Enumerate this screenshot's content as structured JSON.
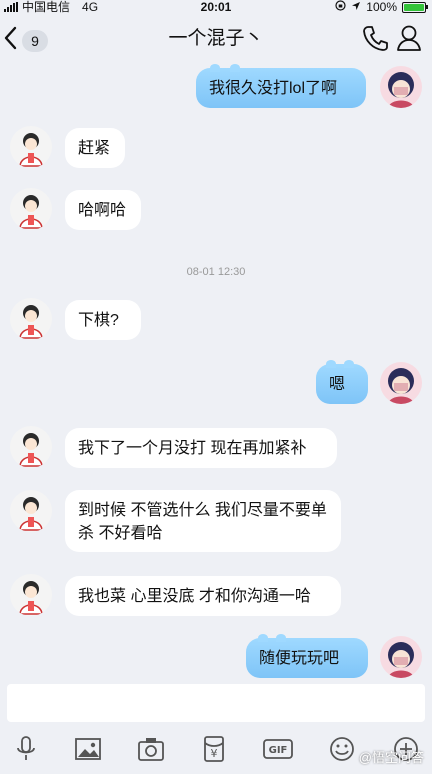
{
  "status": {
    "carrier": "中国电信",
    "network": "4G",
    "time": "20:01",
    "battery": "100%",
    "battery_level": 1.0
  },
  "nav": {
    "back_count": "9",
    "title": "一个混子丶"
  },
  "messages": [
    {
      "side": "out",
      "text": "我很久没打lol了啊"
    },
    {
      "side": "in",
      "text": "赶紧"
    },
    {
      "side": "in",
      "text": "哈啊哈"
    },
    {
      "side": "in",
      "text": "下棋?"
    },
    {
      "side": "out",
      "text": "嗯"
    },
    {
      "side": "in",
      "text": "我下了一个月没打 现在再加紧补"
    },
    {
      "side": "in",
      "text": "到时候 不管选什么 我们尽量不要单杀 不好看哈"
    },
    {
      "side": "in",
      "text": "我也菜 心里没底 才和你沟通一哈"
    },
    {
      "side": "out",
      "text": "随便玩玩吧"
    }
  ],
  "timestamp": "08-01 12:30",
  "toolbar": {
    "icons": [
      "microphone-icon",
      "image-icon",
      "camera-icon",
      "red-packet-icon",
      "gif-icon",
      "emoji-icon",
      "plus-icon"
    ],
    "gif_label": "GIF",
    "redpacket_symbol": "¥"
  },
  "watermark": "@悟空问答",
  "colors": {
    "background": "#eef0f5",
    "bubble_out": "#8ccdfb",
    "bubble_in": "#ffffff",
    "battery_green": "#33c33a"
  }
}
